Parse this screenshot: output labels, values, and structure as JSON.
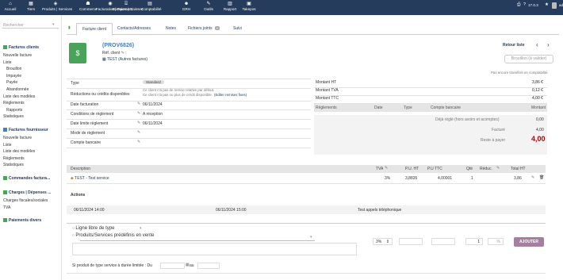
{
  "topmenu": [
    {
      "label": "Accueil",
      "icon": "home-icon",
      "glyph": "⌂"
    },
    {
      "label": "Tiers",
      "icon": "building-icon",
      "glyph": "▦"
    },
    {
      "label": "Produits | Services",
      "icon": "cube-icon",
      "glyph": "◈"
    },
    {
      "label": "Commerce",
      "icon": "briefcase-icon",
      "glyph": "☗"
    },
    {
      "label": "Facturation | Paiement",
      "icon": "coins-icon",
      "glyph": "◉"
    },
    {
      "label": "Banques | Caisses",
      "icon": "bank-icon",
      "glyph": "⌸"
    },
    {
      "label": "Comptabilité",
      "icon": "calculator-icon",
      "glyph": "▤"
    },
    {
      "label": "GRH",
      "icon": "users-icon",
      "glyph": "☻"
    },
    {
      "label": "Outils",
      "icon": "wrench-icon",
      "glyph": "✎"
    },
    {
      "label": "Rapport",
      "icon": "chart-icon",
      "glyph": "▥"
    },
    {
      "label": "Takepos",
      "icon": "cash-register-icon",
      "glyph": "▣"
    }
  ],
  "topright": {
    "version": "17.0.3",
    "user": "admin"
  },
  "sidebar": {
    "search_placeholder": "Rechercher",
    "sections": [
      {
        "title": "Factures clients",
        "color": "#4aa35a",
        "items": [
          "Nouvelle facture",
          "Liste",
          "Brouillon",
          "Impayée",
          "Payée",
          "Abandonnée",
          "Liste des modèles",
          "Règlements",
          "Rapports",
          "Statistiques"
        ]
      },
      {
        "title": "Factures fournisseur",
        "color": "#4a7fb5",
        "items": [
          "Nouvelle facture",
          "Liste",
          "Liste des modèles",
          "Règlements",
          "Statistiques"
        ]
      },
      {
        "title": "Commandes factura...",
        "color": "#4aa35a",
        "items": []
      },
      {
        "title": "Charges | Dépenses ...",
        "color": "#4aa35a",
        "items": [
          "Charges fiscales/sociales",
          "TVA"
        ]
      },
      {
        "title": "Paiements divers",
        "color": "#4aa35a",
        "items": []
      }
    ]
  },
  "tabs": [
    {
      "label": "Facture client"
    },
    {
      "label": "Contacts/Adresses"
    },
    {
      "label": "Notes"
    },
    {
      "label": "Fichiers joints",
      "badge": "0"
    },
    {
      "label": "Suivi"
    }
  ],
  "invoice": {
    "ref": "(PROV6826)",
    "ref_client": "Réf. client",
    "thirdparty": "TEST (Autres factures)",
    "back_link": "Retour liste",
    "status_btn": "Brouillon (à valider)",
    "accounting_note": "Pas encore transféré en comptabilité"
  },
  "fields": {
    "type_label": "Type",
    "type_value": "Standard",
    "discount_label": "Réductions ou crédits disponibles",
    "discount_l1": "Ce client n'a pas de remise relative par défaut.",
    "discount_l2": "Ce client n'a pas ou plus de crédit disponible.",
    "discount_link": "(Editer remises fixes)",
    "date_label": "Date facturation",
    "date_value": "06/11/2024",
    "cond_label": "Conditions de règlement",
    "cond_value": "A réception",
    "due_label": "Date limite règlement",
    "due_value": "06/11/2024",
    "mode_label": "Mode de règlement",
    "bank_label": "Compte bancaire"
  },
  "amounts": {
    "ht_label": "Montant HT",
    "ht": "3,86 €",
    "tva_label": "Montant TVA",
    "tva": "0,12 €",
    "ttc_label": "Montant TTC",
    "ttc": "4,00 €"
  },
  "payments": {
    "headers": [
      "Règlements",
      "Date",
      "Type",
      "Compte bancaire",
      "Montant"
    ],
    "already_label": "Déjà réglé (hors avoirs et acomptes)",
    "already": "0,00",
    "billed_label": "Facturé",
    "billed": "4,00",
    "remain_label": "Reste à payer",
    "remain": "4,00"
  },
  "lines": {
    "headers": {
      "desc": "Description",
      "tva": "TVA",
      "pu_ht": "P.U. HT",
      "pu_ttc": "P.U TTC",
      "qty": "Qté",
      "reduc": "Réduc.",
      "total": "Total HT"
    },
    "rows": [
      {
        "desc": "TEST - Test service",
        "tva": "3%",
        "pu_ht": "3,8835",
        "pu_ttc": "4,00001",
        "qty": "1",
        "reduc": "",
        "total": "3,86"
      }
    ]
  },
  "actions": {
    "title": "Actions",
    "rows": [
      {
        "d1": "06/11/2024 14:00",
        "d2": "06/11/2024 15:00",
        "label": "Test appels téléphonique"
      }
    ]
  },
  "addline": {
    "free_label": "Ligne libre de type",
    "predef_label": "Produits/Services prédéfinis en vente",
    "tva": "3%",
    "qty": "1",
    "pct": "%",
    "button": "AJOUTER",
    "service_note": "Si produit de type service à durée limitée : Du",
    "au": "au"
  }
}
